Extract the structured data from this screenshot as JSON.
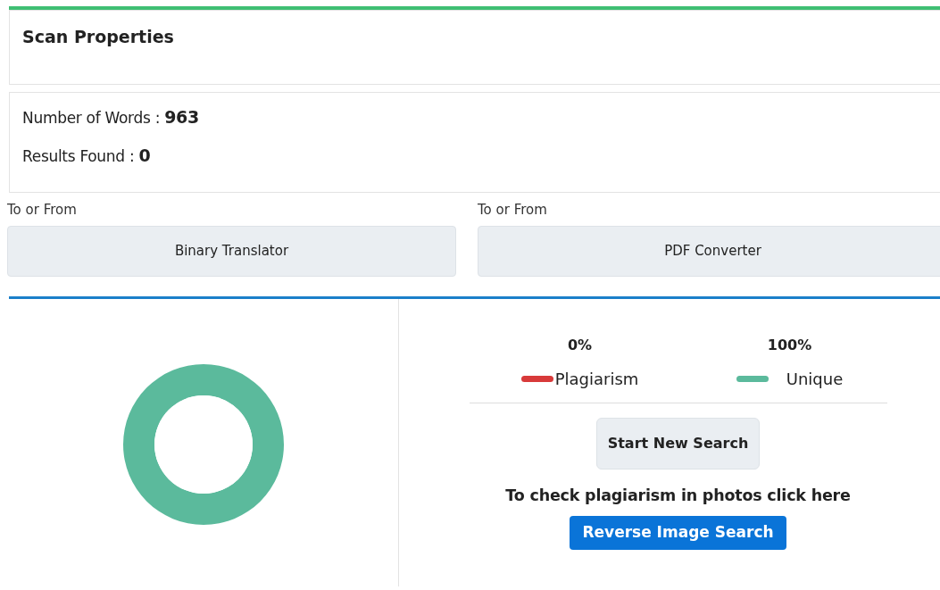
{
  "scan_properties": {
    "title": "Scan Properties"
  },
  "stats": [
    {
      "label": "Number of Words :",
      "value": "963"
    },
    {
      "label": "Results Found :",
      "value": "0"
    }
  ],
  "tools": [
    {
      "caption": "To or From",
      "button": "Binary Translator"
    },
    {
      "caption": "To or From",
      "button": "PDF Converter"
    }
  ],
  "result": {
    "chart_data": {
      "type": "donut",
      "values": [
        0,
        100
      ]
    },
    "legend": [
      {
        "percent": "0%",
        "label": "Plagiarism",
        "color": "#d83a3a"
      },
      {
        "percent": "100%",
        "label": "Unique",
        "color": "#5bba9c"
      }
    ],
    "new_search_button": "Start New Search",
    "photo_hint": "To check plagiarism in photos click here",
    "reverse_image_button": "Reverse Image Search"
  }
}
